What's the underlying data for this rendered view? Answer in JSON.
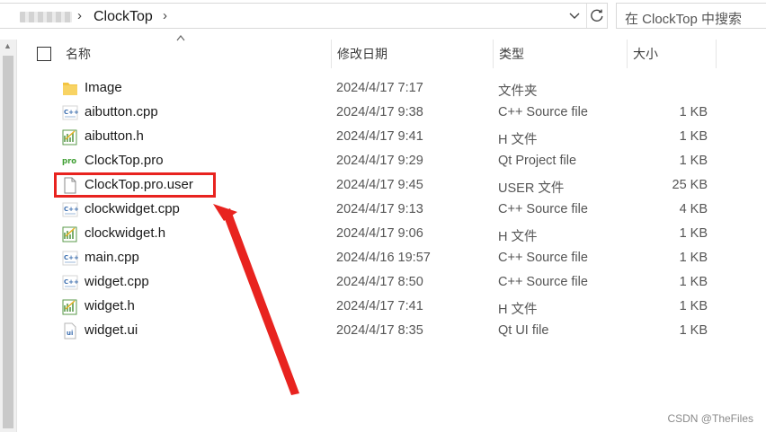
{
  "address": {
    "current_folder": "ClockTop",
    "separator": "›",
    "dropdown_icon": "chevron-down-icon",
    "refresh_icon": "refresh-icon"
  },
  "search": {
    "placeholder": "在 ClockTop 中搜索"
  },
  "columns": {
    "name": "名称",
    "date": "修改日期",
    "type": "类型",
    "size": "大小"
  },
  "files": [
    {
      "name": "Image",
      "date": "2024/4/17 7:17",
      "type": "文件夹",
      "size": "",
      "icon": "folder-icon"
    },
    {
      "name": "aibutton.cpp",
      "date": "2024/4/17 9:38",
      "type": "C++ Source file",
      "size": "1 KB",
      "icon": "cpp-file-icon"
    },
    {
      "name": "aibutton.h",
      "date": "2024/4/17 9:41",
      "type": "H 文件",
      "size": "1 KB",
      "icon": "header-file-icon"
    },
    {
      "name": "ClockTop.pro",
      "date": "2024/4/17 9:29",
      "type": "Qt Project file",
      "size": "1 KB",
      "icon": "pro-file-icon"
    },
    {
      "name": "ClockTop.pro.user",
      "date": "2024/4/17 9:45",
      "type": "USER 文件",
      "size": "25 KB",
      "icon": "blank-file-icon"
    },
    {
      "name": "clockwidget.cpp",
      "date": "2024/4/17 9:13",
      "type": "C++ Source file",
      "size": "4 KB",
      "icon": "cpp-file-icon"
    },
    {
      "name": "clockwidget.h",
      "date": "2024/4/17 9:06",
      "type": "H 文件",
      "size": "1 KB",
      "icon": "header-file-icon"
    },
    {
      "name": "main.cpp",
      "date": "2024/4/16 19:57",
      "type": "C++ Source file",
      "size": "1 KB",
      "icon": "cpp-file-icon"
    },
    {
      "name": "widget.cpp",
      "date": "2024/4/17 8:50",
      "type": "C++ Source file",
      "size": "1 KB",
      "icon": "cpp-file-icon"
    },
    {
      "name": "widget.h",
      "date": "2024/4/17 7:41",
      "type": "H 文件",
      "size": "1 KB",
      "icon": "header-file-icon"
    },
    {
      "name": "widget.ui",
      "date": "2024/4/17 8:35",
      "type": "Qt UI file",
      "size": "1 KB",
      "icon": "ui-file-icon"
    }
  ],
  "annotation": {
    "highlight_color": "#e8231f",
    "highlighted_file": "ClockTop.pro.user"
  },
  "watermark": "CSDN @TheFiles"
}
